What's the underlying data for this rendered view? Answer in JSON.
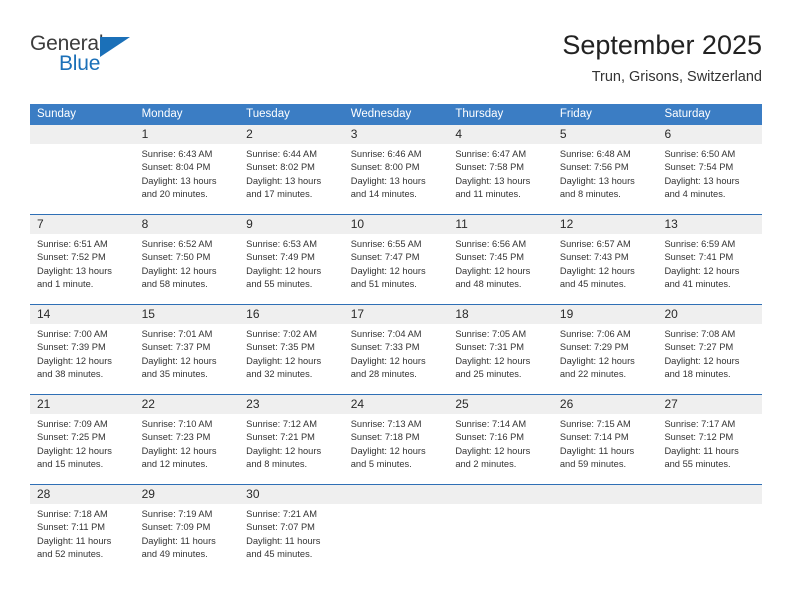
{
  "brand": {
    "line1": "General",
    "line2": "Blue",
    "flag_color": "#1b70b8"
  },
  "header": {
    "title": "September 2025",
    "subtitle": "Trun, Grisons, Switzerland"
  },
  "theme": {
    "header_blue": "#3b7dc4",
    "row_line_blue": "#2f6fb5",
    "day_band_gray": "#efefef"
  },
  "calendar": {
    "weekday_headers": [
      "Sunday",
      "Monday",
      "Tuesday",
      "Wednesday",
      "Thursday",
      "Friday",
      "Saturday"
    ],
    "weeks": [
      [
        {
          "day": "",
          "sunrise": "",
          "sunset": "",
          "daylight": "",
          "empty": true
        },
        {
          "day": "1",
          "sunrise": "Sunrise: 6:43 AM",
          "sunset": "Sunset: 8:04 PM",
          "daylight": "Daylight: 13 hours and 20 minutes."
        },
        {
          "day": "2",
          "sunrise": "Sunrise: 6:44 AM",
          "sunset": "Sunset: 8:02 PM",
          "daylight": "Daylight: 13 hours and 17 minutes."
        },
        {
          "day": "3",
          "sunrise": "Sunrise: 6:46 AM",
          "sunset": "Sunset: 8:00 PM",
          "daylight": "Daylight: 13 hours and 14 minutes."
        },
        {
          "day": "4",
          "sunrise": "Sunrise: 6:47 AM",
          "sunset": "Sunset: 7:58 PM",
          "daylight": "Daylight: 13 hours and 11 minutes."
        },
        {
          "day": "5",
          "sunrise": "Sunrise: 6:48 AM",
          "sunset": "Sunset: 7:56 PM",
          "daylight": "Daylight: 13 hours and 8 minutes."
        },
        {
          "day": "6",
          "sunrise": "Sunrise: 6:50 AM",
          "sunset": "Sunset: 7:54 PM",
          "daylight": "Daylight: 13 hours and 4 minutes."
        }
      ],
      [
        {
          "day": "7",
          "sunrise": "Sunrise: 6:51 AM",
          "sunset": "Sunset: 7:52 PM",
          "daylight": "Daylight: 13 hours and 1 minute."
        },
        {
          "day": "8",
          "sunrise": "Sunrise: 6:52 AM",
          "sunset": "Sunset: 7:50 PM",
          "daylight": "Daylight: 12 hours and 58 minutes."
        },
        {
          "day": "9",
          "sunrise": "Sunrise: 6:53 AM",
          "sunset": "Sunset: 7:49 PM",
          "daylight": "Daylight: 12 hours and 55 minutes."
        },
        {
          "day": "10",
          "sunrise": "Sunrise: 6:55 AM",
          "sunset": "Sunset: 7:47 PM",
          "daylight": "Daylight: 12 hours and 51 minutes."
        },
        {
          "day": "11",
          "sunrise": "Sunrise: 6:56 AM",
          "sunset": "Sunset: 7:45 PM",
          "daylight": "Daylight: 12 hours and 48 minutes."
        },
        {
          "day": "12",
          "sunrise": "Sunrise: 6:57 AM",
          "sunset": "Sunset: 7:43 PM",
          "daylight": "Daylight: 12 hours and 45 minutes."
        },
        {
          "day": "13",
          "sunrise": "Sunrise: 6:59 AM",
          "sunset": "Sunset: 7:41 PM",
          "daylight": "Daylight: 12 hours and 41 minutes."
        }
      ],
      [
        {
          "day": "14",
          "sunrise": "Sunrise: 7:00 AM",
          "sunset": "Sunset: 7:39 PM",
          "daylight": "Daylight: 12 hours and 38 minutes."
        },
        {
          "day": "15",
          "sunrise": "Sunrise: 7:01 AM",
          "sunset": "Sunset: 7:37 PM",
          "daylight": "Daylight: 12 hours and 35 minutes."
        },
        {
          "day": "16",
          "sunrise": "Sunrise: 7:02 AM",
          "sunset": "Sunset: 7:35 PM",
          "daylight": "Daylight: 12 hours and 32 minutes."
        },
        {
          "day": "17",
          "sunrise": "Sunrise: 7:04 AM",
          "sunset": "Sunset: 7:33 PM",
          "daylight": "Daylight: 12 hours and 28 minutes."
        },
        {
          "day": "18",
          "sunrise": "Sunrise: 7:05 AM",
          "sunset": "Sunset: 7:31 PM",
          "daylight": "Daylight: 12 hours and 25 minutes."
        },
        {
          "day": "19",
          "sunrise": "Sunrise: 7:06 AM",
          "sunset": "Sunset: 7:29 PM",
          "daylight": "Daylight: 12 hours and 22 minutes."
        },
        {
          "day": "20",
          "sunrise": "Sunrise: 7:08 AM",
          "sunset": "Sunset: 7:27 PM",
          "daylight": "Daylight: 12 hours and 18 minutes."
        }
      ],
      [
        {
          "day": "21",
          "sunrise": "Sunrise: 7:09 AM",
          "sunset": "Sunset: 7:25 PM",
          "daylight": "Daylight: 12 hours and 15 minutes."
        },
        {
          "day": "22",
          "sunrise": "Sunrise: 7:10 AM",
          "sunset": "Sunset: 7:23 PM",
          "daylight": "Daylight: 12 hours and 12 minutes."
        },
        {
          "day": "23",
          "sunrise": "Sunrise: 7:12 AM",
          "sunset": "Sunset: 7:21 PM",
          "daylight": "Daylight: 12 hours and 8 minutes."
        },
        {
          "day": "24",
          "sunrise": "Sunrise: 7:13 AM",
          "sunset": "Sunset: 7:18 PM",
          "daylight": "Daylight: 12 hours and 5 minutes."
        },
        {
          "day": "25",
          "sunrise": "Sunrise: 7:14 AM",
          "sunset": "Sunset: 7:16 PM",
          "daylight": "Daylight: 12 hours and 2 minutes."
        },
        {
          "day": "26",
          "sunrise": "Sunrise: 7:15 AM",
          "sunset": "Sunset: 7:14 PM",
          "daylight": "Daylight: 11 hours and 59 minutes."
        },
        {
          "day": "27",
          "sunrise": "Sunrise: 7:17 AM",
          "sunset": "Sunset: 7:12 PM",
          "daylight": "Daylight: 11 hours and 55 minutes."
        }
      ],
      [
        {
          "day": "28",
          "sunrise": "Sunrise: 7:18 AM",
          "sunset": "Sunset: 7:11 PM",
          "daylight": "Daylight: 11 hours and 52 minutes."
        },
        {
          "day": "29",
          "sunrise": "Sunrise: 7:19 AM",
          "sunset": "Sunset: 7:09 PM",
          "daylight": "Daylight: 11 hours and 49 minutes."
        },
        {
          "day": "30",
          "sunrise": "Sunrise: 7:21 AM",
          "sunset": "Sunset: 7:07 PM",
          "daylight": "Daylight: 11 hours and 45 minutes."
        },
        {
          "day": "",
          "sunrise": "",
          "sunset": "",
          "daylight": "",
          "empty": true
        },
        {
          "day": "",
          "sunrise": "",
          "sunset": "",
          "daylight": "",
          "empty": true
        },
        {
          "day": "",
          "sunrise": "",
          "sunset": "",
          "daylight": "",
          "empty": true
        },
        {
          "day": "",
          "sunrise": "",
          "sunset": "",
          "daylight": "",
          "empty": true
        }
      ]
    ]
  }
}
